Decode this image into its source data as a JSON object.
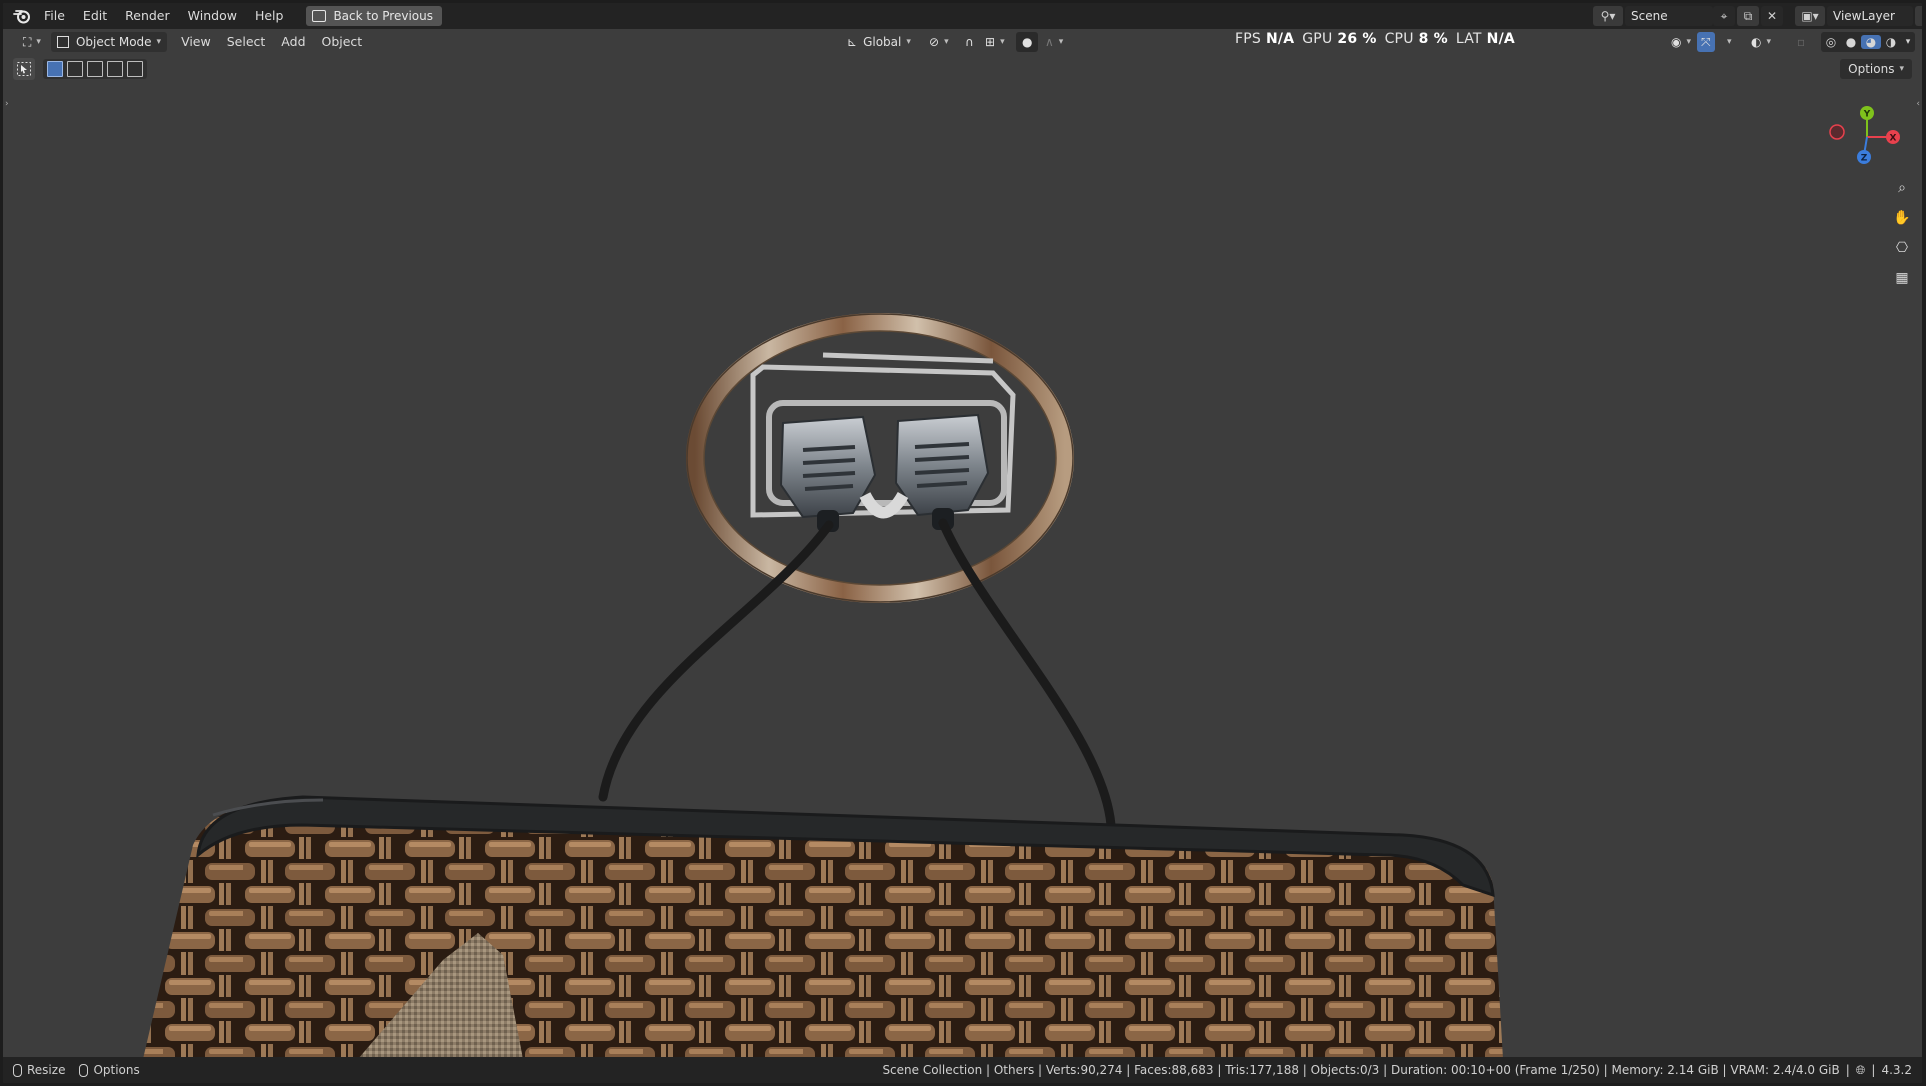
{
  "menubar": {
    "items": [
      "File",
      "Edit",
      "Render",
      "Window",
      "Help"
    ],
    "back_button": "Back to Previous",
    "scene": "Scene",
    "view_layer": "ViewLayer"
  },
  "viewport_header": {
    "mode": "Object Mode",
    "menus": [
      "View",
      "Select",
      "Add",
      "Object"
    ],
    "transform_orientation": "Global"
  },
  "stats_overlay": {
    "fps_label": "FPS",
    "fps_value": "N/A",
    "gpu_label": "GPU",
    "gpu_value": "26 %",
    "cpu_label": "CPU",
    "cpu_value": "8 %",
    "lat_label": "LAT",
    "lat_value": "N/A"
  },
  "options_button": "Options",
  "gizmo": {
    "x": "X",
    "y": "Y",
    "z": "Z"
  },
  "statusbar": {
    "resize": "Resize",
    "options": "Options",
    "info": "Scene Collection | Others | Verts:90,274 | Faces:88,683 | Tris:177,188 | Objects:0/3 | Duration: 00:10+00 (Frame 1/250) | Memory: 2.14 GiB | VRAM: 2.4/4.0 GiB",
    "version": "4.3.2"
  },
  "colors": {
    "viewport_bg": "#3d3d3d",
    "accent": "#4772b3",
    "axis_x": "#e8414d",
    "axis_y": "#7fc21c",
    "axis_z": "#3b7ddd"
  }
}
